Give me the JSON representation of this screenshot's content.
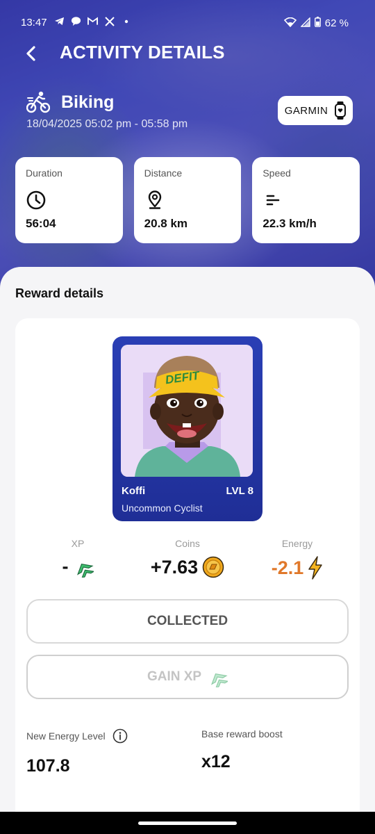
{
  "status_bar": {
    "time": "13:47",
    "battery": "62 %"
  },
  "header": {
    "title": "ACTIVITY DETAILS"
  },
  "activity": {
    "name": "Biking",
    "date": "18/04/2025 05:02 pm - 05:58 pm",
    "source_label": "GARMIN"
  },
  "stats": [
    {
      "label": "Duration",
      "value": "56:04",
      "icon": "clock-icon"
    },
    {
      "label": "Distance",
      "value": "20.8 km",
      "icon": "location-pin-icon"
    },
    {
      "label": "Speed",
      "value": "22.3 km/h",
      "icon": "speed-lines-icon"
    }
  ],
  "reward": {
    "section_title": "Reward details",
    "character": {
      "name": "Koffi",
      "level": "LVL 8",
      "class": "Uncommon Cyclist",
      "cap_text": "DEFIT"
    },
    "xp": {
      "label": "XP",
      "value": "-"
    },
    "coins": {
      "label": "Coins",
      "value": "+7.63"
    },
    "energy": {
      "label": "Energy",
      "value": "-2.1"
    },
    "collected_label": "COLLECTED",
    "gain_xp_label": "GAIN XP",
    "new_energy_label": "New Energy Level",
    "new_energy_value": "107.8",
    "boost_label": "Base reward boost",
    "boost_value": "x12"
  },
  "colors": {
    "accent_blue": "#2a3fb5",
    "energy_orange": "#e0782a",
    "xp_green": "#3fbf6f",
    "coin_gold": "#f0a81c"
  }
}
